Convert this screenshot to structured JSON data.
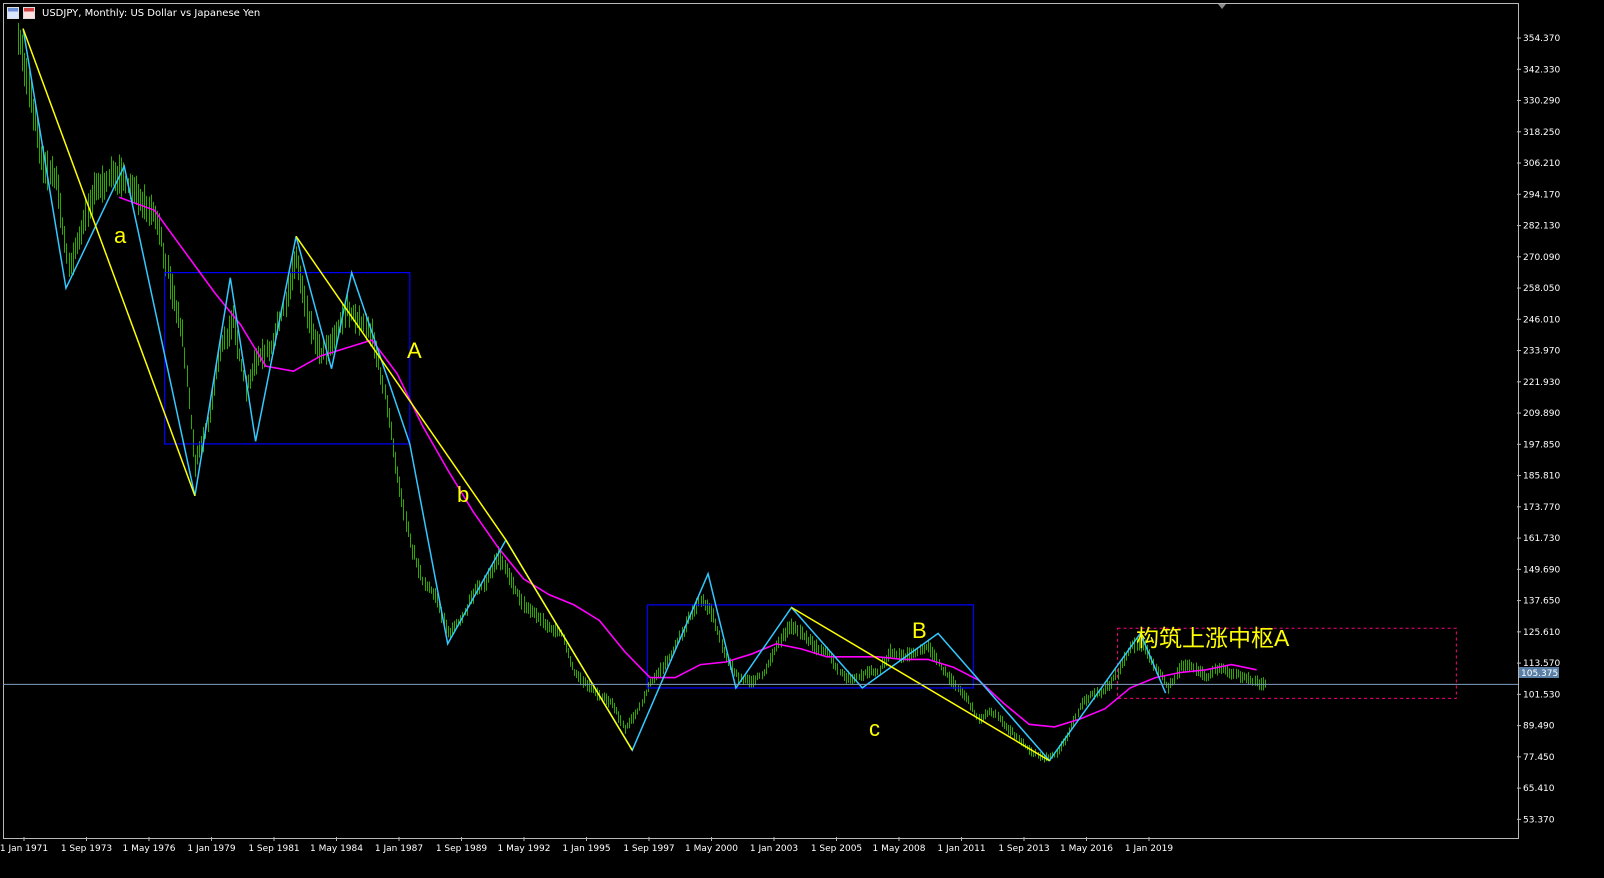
{
  "title": "USDJPY, Monthly:  US Dollar vs Japanese Yen",
  "icons": [
    "chart-window-icon",
    "chart-mode-icon"
  ],
  "current_price": "105.375",
  "colors": {
    "background": "#000000",
    "candles": "#2ea800",
    "zigzag": "#33c8ff",
    "trend": "#ffff00",
    "moving_average": "#ff00ff",
    "zone_box": "#0000ff",
    "dashed_box": "#ff0080",
    "label": "#ffff00",
    "price_line": "#7f9fbf"
  },
  "annotations": {
    "a": "a",
    "b": "b",
    "c": "c",
    "A": "A",
    "B": "B",
    "zone_note": "构筑上涨中枢A"
  },
  "chart_data": {
    "type": "candlestick",
    "symbol": "USDJPY",
    "timeframe": "Monthly",
    "y_ticks": [
      "354.370",
      "342.330",
      "330.290",
      "318.250",
      "306.210",
      "294.170",
      "282.130",
      "270.090",
      "258.050",
      "246.010",
      "233.970",
      "221.930",
      "209.890",
      "197.850",
      "185.810",
      "173.770",
      "161.730",
      "149.690",
      "137.650",
      "125.610",
      "113.570",
      "101.530",
      "89.490",
      "77.450",
      "65.410",
      "53.370"
    ],
    "x_ticks": [
      "1 Jan 1971",
      "1 Sep 1973",
      "1 May 1976",
      "1 Jan 1979",
      "1 Sep 1981",
      "1 May 1984",
      "1 Jan 1987",
      "1 Sep 1989",
      "1 May 1992",
      "1 Jan 1995",
      "1 Sep 1997",
      "1 May 2000",
      "1 Jan 2003",
      "1 Sep 2005",
      "1 May 2008",
      "1 Jan 2011",
      "1 Sep 2013",
      "1 May 2016",
      "1 Jan 2019"
    ],
    "ylim": [
      47.35,
      359.0
    ],
    "xlim": [
      1971.0,
      2030.3
    ],
    "zigzag": [
      [
        1971.2,
        358
      ],
      [
        1972.9,
        258
      ],
      [
        1975.2,
        305
      ],
      [
        1978.0,
        178
      ],
      [
        1979.4,
        262
      ],
      [
        1980.4,
        199
      ],
      [
        1982.0,
        278
      ],
      [
        1983.4,
        227
      ],
      [
        1984.2,
        264
      ],
      [
        1986.5,
        198
      ],
      [
        1988.0,
        121
      ],
      [
        1990.3,
        161
      ],
      [
        1995.3,
        80
      ],
      [
        1998.3,
        148
      ],
      [
        1999.4,
        104
      ],
      [
        2001.6,
        135
      ],
      [
        2004.4,
        104
      ],
      [
        2007.4,
        125
      ],
      [
        2011.8,
        76
      ],
      [
        2015.4,
        125
      ],
      [
        2016.4,
        102
      ]
    ],
    "trend_lines": [
      [
        [
          1971.2,
          358
        ],
        [
          1978.0,
          178
        ]
      ],
      [
        [
          1982.0,
          278
        ],
        [
          1990.3,
          161
        ]
      ],
      [
        [
          1990.3,
          161
        ],
        [
          1995.3,
          80
        ]
      ],
      [
        [
          2001.6,
          135
        ],
        [
          2011.8,
          76
        ]
      ]
    ],
    "moving_average": [
      [
        1975.0,
        293
      ],
      [
        1976.4,
        288
      ],
      [
        1977.6,
        272
      ],
      [
        1978.8,
        256
      ],
      [
        1979.8,
        244
      ],
      [
        1980.8,
        228
      ],
      [
        1981.9,
        226
      ],
      [
        1983.0,
        232
      ],
      [
        1984.0,
        235
      ],
      [
        1985.0,
        238
      ],
      [
        1986.0,
        225
      ],
      [
        1987.0,
        205
      ],
      [
        1988.0,
        188
      ],
      [
        1989.0,
        172
      ],
      [
        1990.0,
        158
      ],
      [
        1991.0,
        146
      ],
      [
        1992.0,
        140
      ],
      [
        1993.0,
        136
      ],
      [
        1994.0,
        130
      ],
      [
        1995.0,
        118
      ],
      [
        1996.0,
        108
      ],
      [
        1997.0,
        108
      ],
      [
        1998.0,
        113
      ],
      [
        1999.0,
        114
      ],
      [
        2000.0,
        117
      ],
      [
        2001.0,
        121
      ],
      [
        2002.0,
        119
      ],
      [
        2003.0,
        116
      ],
      [
        2004.0,
        116
      ],
      [
        2005.0,
        116
      ],
      [
        2006.0,
        115
      ],
      [
        2007.0,
        115
      ],
      [
        2008.0,
        112
      ],
      [
        2009.0,
        107
      ],
      [
        2010.0,
        98
      ],
      [
        2011.0,
        90
      ],
      [
        2012.0,
        89
      ],
      [
        2013.0,
        92
      ],
      [
        2014.0,
        96
      ],
      [
        2015.0,
        104
      ],
      [
        2016.0,
        108
      ],
      [
        2017.0,
        110
      ],
      [
        2018.0,
        111
      ],
      [
        2019.0,
        113
      ],
      [
        2020.0,
        111
      ]
    ],
    "zone_boxes": [
      {
        "x0": 1976.8,
        "x1": 1986.5,
        "y0": 198,
        "y1": 264
      },
      {
        "x0": 1995.9,
        "x1": 2008.8,
        "y0": 104,
        "y1": 136
      }
    ],
    "dashed_box": {
      "x0": 2014.5,
      "x1": 2027.9,
      "y0": 100,
      "y1": 127
    },
    "price_series": [
      [
        1971,
        357
      ],
      [
        1971.5,
        330
      ],
      [
        1972,
        305
      ],
      [
        1972.5,
        300
      ],
      [
        1973,
        265
      ],
      [
        1973.5,
        280
      ],
      [
        1974,
        295
      ],
      [
        1974.5,
        300
      ],
      [
        1975,
        302
      ],
      [
        1975.5,
        295
      ],
      [
        1976,
        292
      ],
      [
        1976.5,
        285
      ],
      [
        1977,
        260
      ],
      [
        1977.5,
        240
      ],
      [
        1978,
        190
      ],
      [
        1978.5,
        205
      ],
      [
        1979,
        235
      ],
      [
        1979.5,
        245
      ],
      [
        1980,
        220
      ],
      [
        1980.5,
        232
      ],
      [
        1981,
        235
      ],
      [
        1981.5,
        250
      ],
      [
        1982,
        270
      ],
      [
        1982.5,
        245
      ],
      [
        1983,
        232
      ],
      [
        1983.5,
        238
      ],
      [
        1984,
        250
      ],
      [
        1984.5,
        245
      ],
      [
        1985,
        240
      ],
      [
        1985.5,
        218
      ],
      [
        1986,
        185
      ],
      [
        1986.5,
        160
      ],
      [
        1987,
        145
      ],
      [
        1987.5,
        140
      ],
      [
        1988,
        125
      ],
      [
        1988.5,
        130
      ],
      [
        1989,
        140
      ],
      [
        1989.5,
        145
      ],
      [
        1990,
        155
      ],
      [
        1990.5,
        145
      ],
      [
        1991,
        136
      ],
      [
        1991.5,
        132
      ],
      [
        1992,
        127
      ],
      [
        1992.5,
        125
      ],
      [
        1993,
        110
      ],
      [
        1993.5,
        105
      ],
      [
        1994,
        101
      ],
      [
        1994.5,
        98
      ],
      [
        1995,
        88
      ],
      [
        1995.5,
        95
      ],
      [
        1996,
        106
      ],
      [
        1996.5,
        112
      ],
      [
        1997,
        120
      ],
      [
        1997.5,
        130
      ],
      [
        1998,
        138
      ],
      [
        1998.5,
        132
      ],
      [
        1999,
        115
      ],
      [
        1999.5,
        108
      ],
      [
        2000,
        106
      ],
      [
        2000.5,
        110
      ],
      [
        2001,
        120
      ],
      [
        2001.5,
        128
      ],
      [
        2002,
        125
      ],
      [
        2002.5,
        120
      ],
      [
        2003,
        118
      ],
      [
        2003.5,
        110
      ],
      [
        2004,
        107
      ],
      [
        2004.5,
        110
      ],
      [
        2005,
        110
      ],
      [
        2005.5,
        118
      ],
      [
        2006,
        116
      ],
      [
        2006.5,
        118
      ],
      [
        2007,
        120
      ],
      [
        2007.5,
        112
      ],
      [
        2008,
        106
      ],
      [
        2008.5,
        100
      ],
      [
        2009,
        92
      ],
      [
        2009.5,
        95
      ],
      [
        2010,
        90
      ],
      [
        2010.5,
        85
      ],
      [
        2011,
        80
      ],
      [
        2011.5,
        77
      ],
      [
        2012,
        78
      ],
      [
        2012.5,
        85
      ],
      [
        2013,
        97
      ],
      [
        2013.5,
        102
      ],
      [
        2014,
        103
      ],
      [
        2014.5,
        110
      ],
      [
        2015,
        120
      ],
      [
        2015.5,
        121
      ],
      [
        2016,
        112
      ],
      [
        2016.5,
        104
      ],
      [
        2017,
        112
      ],
      [
        2017.5,
        112
      ],
      [
        2018,
        108
      ],
      [
        2018.5,
        112
      ],
      [
        2019,
        110
      ],
      [
        2019.5,
        108
      ],
      [
        2020,
        106
      ],
      [
        2020.4,
        105.4
      ]
    ]
  }
}
